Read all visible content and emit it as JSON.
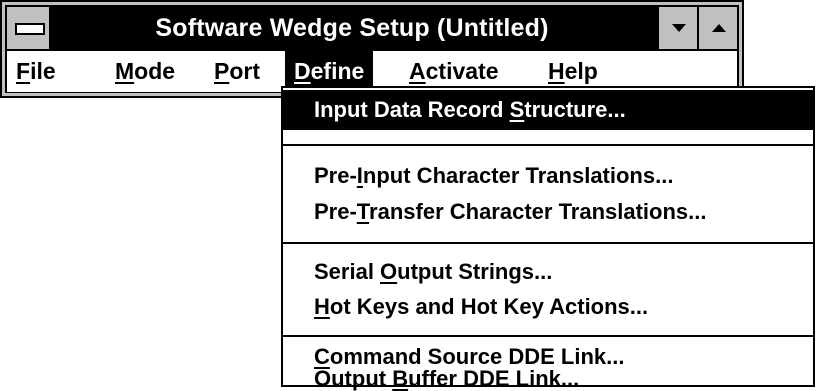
{
  "window": {
    "title": "Software Wedge Setup (Untitled)"
  },
  "menubar": {
    "items": [
      {
        "pre": "",
        "key": "F",
        "post": "ile"
      },
      {
        "pre": "",
        "key": "M",
        "post": "ode"
      },
      {
        "pre": "",
        "key": "P",
        "post": "ort"
      },
      {
        "pre": "",
        "key": "D",
        "post": "efine"
      },
      {
        "pre": "",
        "key": "A",
        "post": "ctivate"
      },
      {
        "pre": "",
        "key": "H",
        "post": "elp"
      }
    ]
  },
  "define_menu": {
    "items": [
      {
        "pre": "Input Data Record ",
        "key": "S",
        "post": "tructure..."
      },
      {
        "pre": "Pre-",
        "key": "I",
        "post": "nput Character Translations..."
      },
      {
        "pre": "Pre-",
        "key": "T",
        "post": "ransfer Character Translations..."
      },
      {
        "pre": "Serial ",
        "key": "O",
        "post": "utput Strings..."
      },
      {
        "pre": "",
        "key": "H",
        "post": "ot Keys and Hot Key Actions..."
      },
      {
        "pre": "",
        "key": "C",
        "post": "ommand Source DDE Link..."
      },
      {
        "pre": "Output ",
        "key": "B",
        "post": "uffer DDE Link..."
      }
    ]
  }
}
